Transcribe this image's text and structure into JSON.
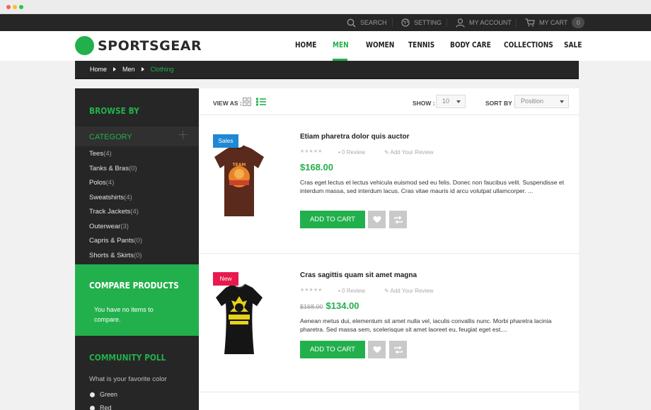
{
  "topbar": {
    "search": "Search",
    "setting": "Setting",
    "account": "My Account",
    "cart": "My Cart",
    "cart_count": "0"
  },
  "header": {
    "logo": "SPORTSGEAR",
    "nav": [
      "HOME",
      "MEN",
      "WOMEN",
      "TENNIS",
      "BODY CARE",
      "COLLECTIONS",
      "SALE"
    ],
    "active_nav": "MEN"
  },
  "breadcrumb": [
    "Home",
    "Men",
    "Clothing"
  ],
  "sidebar": {
    "browse_title": "BROWSE BY",
    "category_label": "Category",
    "categories": [
      {
        "name": "Tees",
        "count": "(4)"
      },
      {
        "name": "Tanks & Bras",
        "count": "(0)"
      },
      {
        "name": "Polos",
        "count": "(4)"
      },
      {
        "name": "Sweatshirts",
        "count": "(4)"
      },
      {
        "name": "Track Jackets",
        "count": "(4)"
      },
      {
        "name": "Outerwear",
        "count": "(3)"
      },
      {
        "name": "Capris & Pants",
        "count": "(0)"
      },
      {
        "name": "Shorts & Skirts",
        "count": "(0)"
      }
    ],
    "compare_title": "COMPARE PRODUCTS",
    "compare_text": "You have no items to compare.",
    "poll_title": "COMMUNITY POLL",
    "poll_question": "What is your favorite color",
    "poll_options": [
      "Green",
      "Red"
    ]
  },
  "toolbar": {
    "view_as": "View as :",
    "show_label": "Show :",
    "show_value": "10",
    "sort_label": "Sort by :",
    "sort_value": "Position"
  },
  "products": [
    {
      "badge": "Sales",
      "title": "Etiam pharetra dolor quis auctor",
      "review": "0 Review",
      "add_review": "Add Your Review",
      "price": "$168.00",
      "old_price": "",
      "description": "Cras eget lectus et lectus vehicula euismod sed eu felis. Donec non faucibus velit. Suspendisse et interdum massa, sed interdum lacus. Cras vitae mauris id arcu volutpat ullamcorper. ...",
      "add_to_cart": "Add to cart",
      "shirt_text": "TEAM Hungry Bears"
    },
    {
      "badge": "New",
      "title": "Cras sagittis quam sit amet magna",
      "review": "0 Review",
      "add_review": "Add Your Review",
      "price": "$134.00",
      "old_price": "$168.00",
      "description": "Aenean metus dui, elementum sit amet nulla vel, iaculis convallis nunc. Morbi pharetra lacinia pharetra. Sed massa sem, scelerisque sit amet laoreet eu, feugiat eget est....",
      "add_to_cart": "Add to cart",
      "shirt_text": "GOGOL BORDELLO"
    }
  ],
  "colors": {
    "accent": "#22b04c",
    "dark": "#262626",
    "badge_sales": "#1e88d4",
    "badge_new": "#e8194d"
  }
}
